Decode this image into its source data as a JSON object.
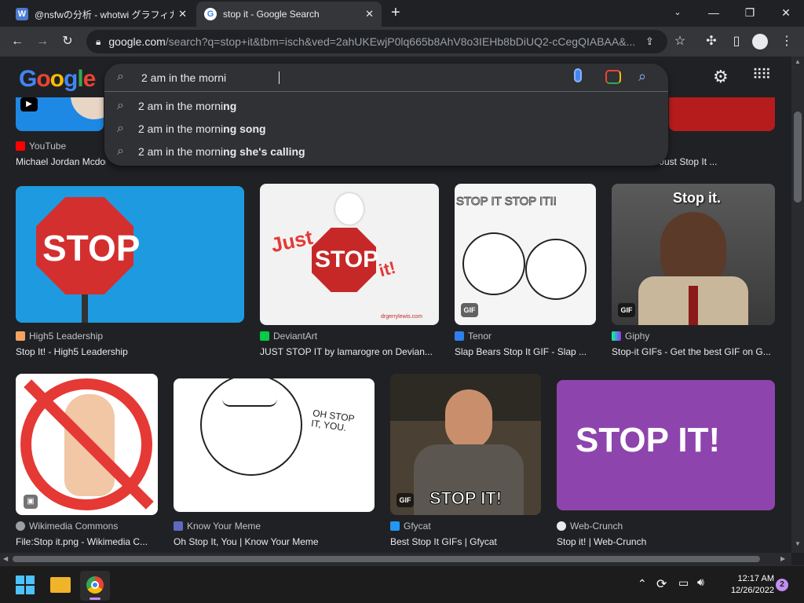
{
  "browser": {
    "tabs": [
      {
        "title": "@nsfwの分析 - whotwi グラフィカル",
        "favicon": "W",
        "active": false
      },
      {
        "title": "stop it - Google Search",
        "favicon": "G",
        "active": true
      }
    ],
    "new_tab": "+",
    "address": {
      "host": "google.com",
      "path": "/search?q=stop+it&tbm=isch&ved=2ahUKEwjP0lq665b8AhV8o3IEHb8bDiUQ2-cCegQIABAA&..."
    }
  },
  "google": {
    "logo": "Google",
    "search_query": "2 am in the morni",
    "suggestions": [
      {
        "typed": "2 am in the morni",
        "rest": "ng"
      },
      {
        "typed": "2 am in the morni",
        "rest": "ng song"
      },
      {
        "typed": "2 am in the morni",
        "rest": "ng she's calling"
      }
    ]
  },
  "results_top": [
    {
      "source": "YouTube",
      "caption": "Michael Jordan Mcdon"
    },
    {
      "source": "",
      "caption": "Just Stop It ..."
    }
  ],
  "results_row1": [
    {
      "source": "High5 Leadership",
      "caption": "Stop It! - High5 Leadership",
      "image_text": "STOP"
    },
    {
      "source": "DeviantArt",
      "caption": "JUST STOP IT by lamarogre on Devian...",
      "image_text": "STOP",
      "image_text2": "Just",
      "image_text3": "it!",
      "image_credit": "drgerrylewis.com"
    },
    {
      "source": "Tenor",
      "caption": "Slap Bears Stop It GIF - Slap ...",
      "image_text": "STOP IT STOP IT!!",
      "badge": "GIF"
    },
    {
      "source": "Giphy",
      "caption": "Stop-it GIFs - Get the best GIF on G...",
      "image_text": "Stop it.",
      "badge": "GIF"
    }
  ],
  "results_row2": [
    {
      "source": "Wikimedia Commons",
      "caption": "File:Stop it.png - Wikimedia C..."
    },
    {
      "source": "Know Your Meme",
      "caption": "Oh Stop It, You | Know Your Meme",
      "image_text": "OH STOP IT, YOU."
    },
    {
      "source": "Gfycat",
      "caption": "Best Stop It GIFs | Gfycat",
      "image_text": "STOP IT!",
      "badge": "GIF"
    },
    {
      "source": "Web-Crunch",
      "caption": "Stop it! | Web-Crunch",
      "image_text": "STOP IT!"
    }
  ],
  "taskbar": {
    "time": "12:17 AM",
    "date": "12/26/2022",
    "notifications": "2"
  },
  "colors": {
    "bg": "#202124",
    "toolbar": "#35363a",
    "accent": "#8ab4f8",
    "stop_red": "#d32f2f",
    "purple": "#8e44ad"
  }
}
